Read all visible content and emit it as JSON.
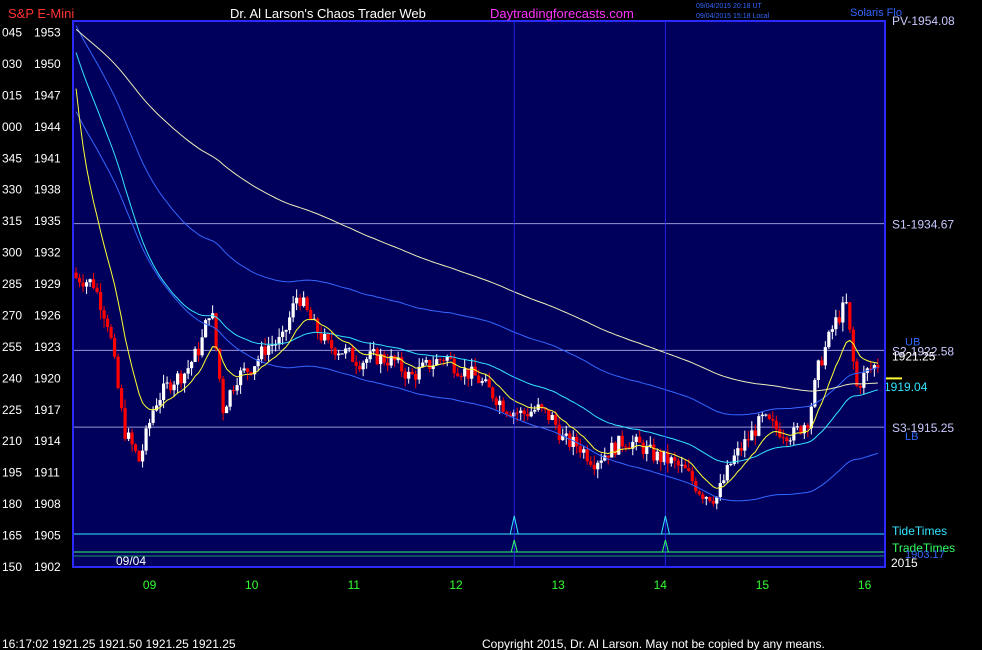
{
  "header": {
    "instrument": "S&P E-Mini",
    "author": "Dr. Al Larson's Chaos Trader Web",
    "site": "Daytradingforecasts.com",
    "stamp_utc": "09/04/2015 20:18 UT",
    "stamp_local": "09/04/2015 15:18 Local",
    "top_right_label": "Solaris Flo"
  },
  "footer": {
    "quote_line": "16:17:02  1921.25  1921.50  1921.25  1921.25",
    "copyright": "Copyright 2015, Dr. Al Larson. May not be copied by any means."
  },
  "colors": {
    "background": "#000000",
    "plot_bg": "#00005c",
    "frame": "#2a2aff",
    "axis_text": "#ffffff",
    "time_labels": "#33ff33",
    "candle_up": "#ffffff",
    "candle_down": "#ff0000",
    "ema_fast": "#ffff33",
    "ema_mid": "#33e6ff",
    "ema_slow": "#eeeebb",
    "band": "#3366ff",
    "pivot_line": "#c8c8ff",
    "tide": "#33e6ff",
    "trade": "#33ff66",
    "site": "#ff33ff",
    "instrument": "#ff3333"
  },
  "chart_data": {
    "type": "candlestick",
    "title": "S&P E-Mini",
    "date_label": "09/04",
    "year_label": "2015",
    "x_hours": [
      9,
      10,
      11,
      12,
      13,
      14,
      15,
      16
    ],
    "x_range": [
      8.25,
      16.2
    ],
    "y_range": [
      1902,
      1954
    ],
    "y_ticks": [
      {
        "time": "045",
        "price": 1953
      },
      {
        "time": "030",
        "price": 1950
      },
      {
        "time": "015",
        "price": 1947
      },
      {
        "time": "000",
        "price": 1944
      },
      {
        "time": "345",
        "price": 1941
      },
      {
        "time": "330",
        "price": 1938
      },
      {
        "time": "315",
        "price": 1935
      },
      {
        "time": "300",
        "price": 1932
      },
      {
        "time": "285",
        "price": 1929
      },
      {
        "time": "270",
        "price": 1926
      },
      {
        "time": "255",
        "price": 1923
      },
      {
        "time": "240",
        "price": 1920
      },
      {
        "time": "225",
        "price": 1917
      },
      {
        "time": "210",
        "price": 1914
      },
      {
        "time": "195",
        "price": 1911
      },
      {
        "time": "180",
        "price": 1908
      },
      {
        "time": "165",
        "price": 1905
      },
      {
        "time": "150",
        "price": 1902
      }
    ],
    "levels": [
      {
        "label": "PV-1954.08",
        "price": 1954.08
      },
      {
        "label": "S1-1934.67",
        "price": 1934.67
      },
      {
        "label": "S2-1922.58",
        "price": 1922.58
      },
      {
        "label": "S3-1915.25",
        "price": 1915.25
      }
    ],
    "band_labels": [
      {
        "label": "UB",
        "price": 1923.4
      },
      {
        "label": "LB",
        "price": 1914.4
      }
    ],
    "last_price_label": "1921.25",
    "ema_label": "1919.04",
    "tide_label": "TideTimes",
    "trade_label": "TradeTimes",
    "bottom_right_label": "1903.17",
    "tide_marks": [
      12.57,
      14.05
    ],
    "anchors_close": [
      [
        8.3,
        1929.5
      ],
      [
        8.45,
        1929.0
      ],
      [
        8.6,
        1925.0
      ],
      [
        8.75,
        1915.0
      ],
      [
        8.9,
        1912.0
      ],
      [
        9.05,
        1917.5
      ],
      [
        9.2,
        1919.5
      ],
      [
        9.35,
        1920.5
      ],
      [
        9.5,
        1923.0
      ],
      [
        9.6,
        1927.0
      ],
      [
        9.72,
        1917.0
      ],
      [
        9.85,
        1920.0
      ],
      [
        10.0,
        1921.0
      ],
      [
        10.15,
        1923.0
      ],
      [
        10.3,
        1923.5
      ],
      [
        10.45,
        1928.0
      ],
      [
        10.6,
        1925.0
      ],
      [
        10.75,
        1923.0
      ],
      [
        10.9,
        1922.5
      ],
      [
        11.05,
        1921.5
      ],
      [
        11.2,
        1922.0
      ],
      [
        11.4,
        1921.5
      ],
      [
        11.55,
        1920.0
      ],
      [
        11.7,
        1921.0
      ],
      [
        11.9,
        1922.0
      ],
      [
        12.0,
        1921.0
      ],
      [
        12.2,
        1920.0
      ],
      [
        12.35,
        1918.5
      ],
      [
        12.5,
        1917.0
      ],
      [
        12.65,
        1916.5
      ],
      [
        12.8,
        1917.0
      ],
      [
        12.95,
        1916.0
      ],
      [
        13.05,
        1914.0
      ],
      [
        13.2,
        1913.5
      ],
      [
        13.35,
        1912.0
      ],
      [
        13.5,
        1913.0
      ],
      [
        13.65,
        1914.0
      ],
      [
        13.8,
        1913.5
      ],
      [
        13.95,
        1912.5
      ],
      [
        14.1,
        1912.0
      ],
      [
        14.25,
        1911.0
      ],
      [
        14.4,
        1909.0
      ],
      [
        14.55,
        1908.5
      ],
      [
        14.7,
        1912.0
      ],
      [
        14.85,
        1914.0
      ],
      [
        15.0,
        1916.0
      ],
      [
        15.15,
        1915.0
      ],
      [
        15.3,
        1914.5
      ],
      [
        15.45,
        1916.0
      ],
      [
        15.55,
        1921.0
      ],
      [
        15.7,
        1925.0
      ],
      [
        15.82,
        1927.0
      ],
      [
        15.92,
        1919.0
      ],
      [
        16.02,
        1920.5
      ],
      [
        16.12,
        1921.25
      ]
    ]
  }
}
